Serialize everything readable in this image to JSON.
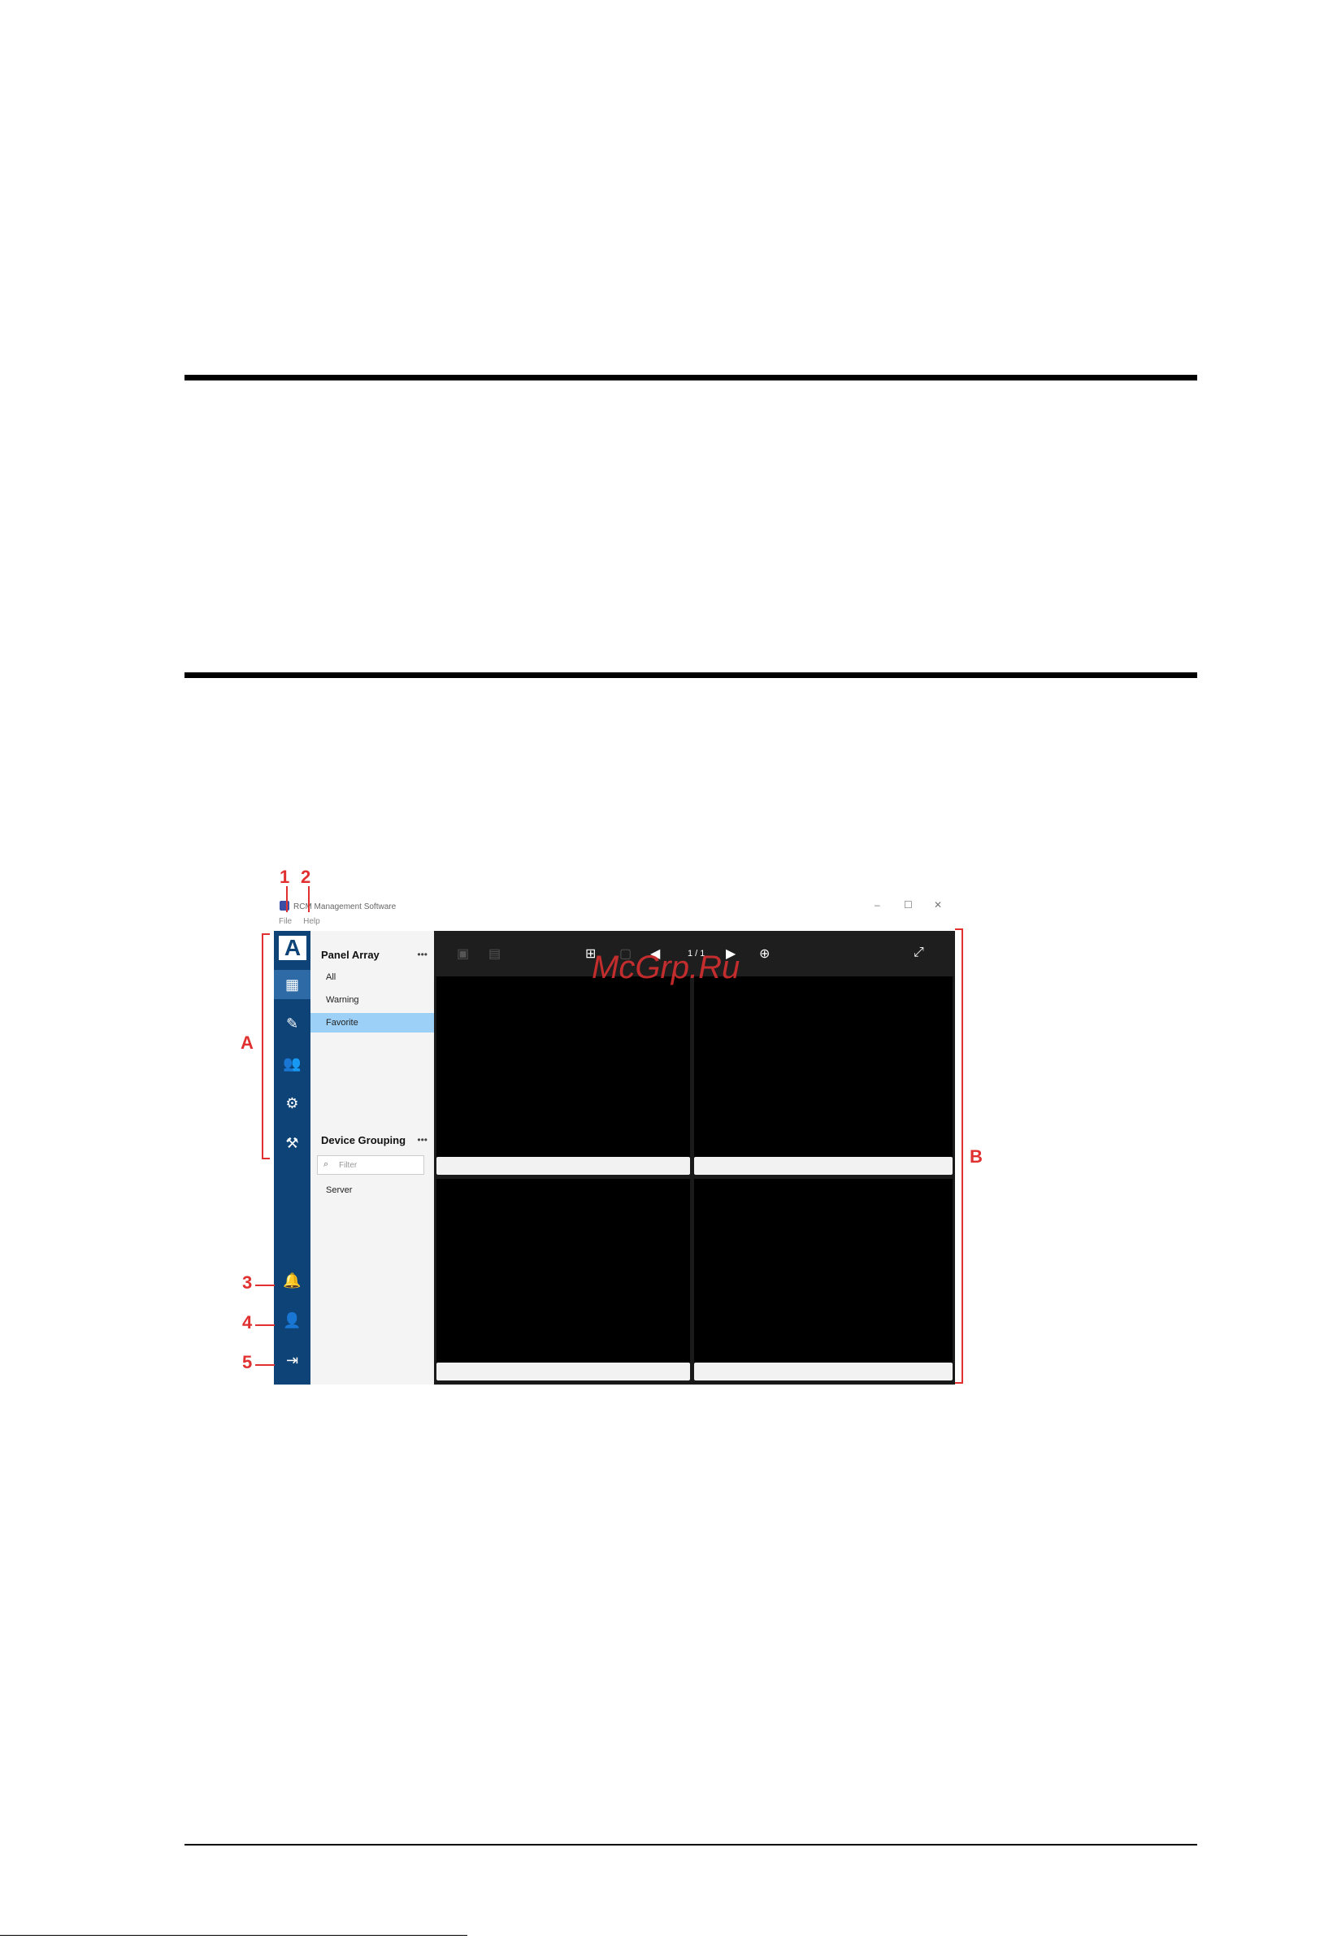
{
  "window": {
    "title": "RCM Management Software",
    "controls": [
      "–",
      "☐",
      "✕"
    ],
    "menu": [
      "File",
      "Help"
    ]
  },
  "panel": {
    "panel_array_title": "Panel Array",
    "panel_array_items": [
      "All",
      "Warning",
      "Favorite"
    ],
    "selected_item": "Favorite",
    "device_grouping_title": "Device Grouping",
    "filter_placeholder": "Filter",
    "groups": [
      "Server"
    ],
    "more": "•••"
  },
  "toolbar": {
    "pager": "1 / 1"
  },
  "callouts": {
    "n1": "1",
    "n2": "2",
    "n3": "3",
    "n4": "4",
    "n5": "5",
    "a": "A",
    "b": "B"
  },
  "watermark": "McGrp.Ru",
  "colors": {
    "sidebar": "#0d4377",
    "selection": "#9dd0f7",
    "callout": "#e03030"
  }
}
